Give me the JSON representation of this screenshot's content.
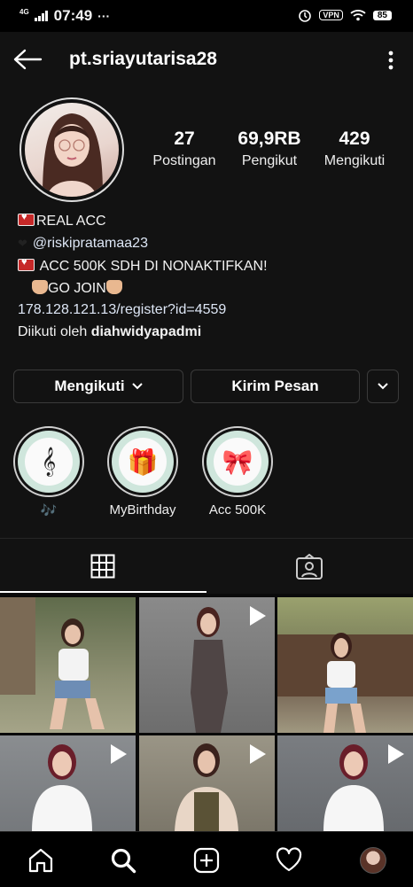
{
  "status_bar": {
    "time": "07:49",
    "network": "4G",
    "dots": "···",
    "vpn": "VPN",
    "battery": "85"
  },
  "header": {
    "username": "pt.sriayutarisa28"
  },
  "stats": [
    {
      "value": "27",
      "label": "Postingan"
    },
    {
      "value": "69,9RB",
      "label": "Pengikut"
    },
    {
      "value": "429",
      "label": "Mengikuti"
    }
  ],
  "bio": {
    "line1": "REAL ACC",
    "line2": "@riskipratamaa23",
    "line3": "ACC 500K SDH DI NONAKTIFKAN!",
    "line4": "GO JOIN",
    "link": "178.128.121.13/register?id=4559",
    "followed_by_prefix": "Diikuti oleh ",
    "followed_by_user": "diahwidyapadmi"
  },
  "buttons": {
    "following": "Mengikuti",
    "message": "Kirim Pesan"
  },
  "highlights": [
    {
      "label": "🎶",
      "icon": "treble-clef-icon",
      "glyph": "𝄞"
    },
    {
      "label": "MyBirthday",
      "icon": "gift-icon",
      "glyph": "🎁"
    },
    {
      "label": "Acc 500K",
      "icon": "bow-icon",
      "glyph": "🎀"
    }
  ],
  "tabs": [
    {
      "name": "grid-tab",
      "icon": "grid-icon",
      "active": true
    },
    {
      "name": "tagged-tab",
      "icon": "tagged-person-icon",
      "active": false
    }
  ],
  "posts": [
    {
      "is_video": false,
      "bg": "#6d7f5f"
    },
    {
      "is_video": true,
      "bg": "#7a7a7a"
    },
    {
      "is_video": false,
      "bg": "#8a8f6a"
    },
    {
      "is_video": true,
      "bg": "#7c7f83"
    },
    {
      "is_video": true,
      "bg": "#8b8578"
    },
    {
      "is_video": true,
      "bg": "#6f7377"
    }
  ],
  "bottom_nav": [
    "home-icon",
    "search-icon",
    "add-post-icon",
    "activity-heart-icon",
    "profile-avatar-icon"
  ]
}
